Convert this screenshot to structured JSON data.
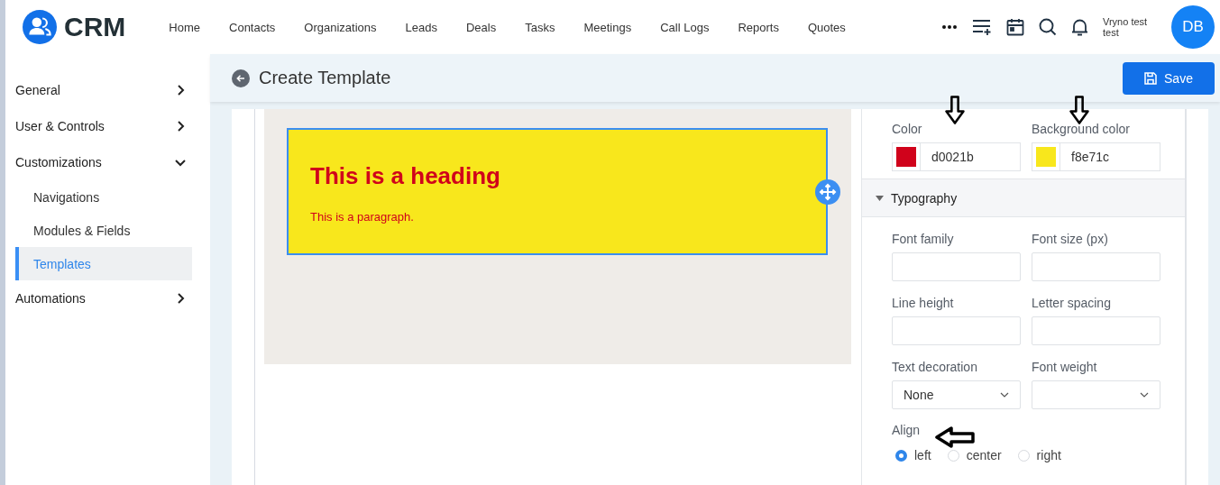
{
  "header": {
    "logo": "CRM",
    "nav": [
      {
        "label": "Home",
        "selected": false
      },
      {
        "label": "Contacts",
        "selected": false
      },
      {
        "label": "Organizations",
        "selected": false
      },
      {
        "label": "Leads",
        "selected": false
      },
      {
        "label": "Deals",
        "selected": false
      },
      {
        "label": "Tasks",
        "selected": false
      },
      {
        "label": "Meetings",
        "selected": false
      },
      {
        "label": "Call Logs",
        "selected": false
      },
      {
        "label": "Reports",
        "selected": false
      },
      {
        "label": "Quotes",
        "selected": false
      }
    ],
    "user_name": "Vryno test test",
    "avatar": "DB"
  },
  "sidebar": {
    "items": [
      {
        "label": "General",
        "expanded": false
      },
      {
        "label": "User & Controls",
        "expanded": false
      },
      {
        "label": "Customizations",
        "expanded": true,
        "children": [
          {
            "label": "Navigations",
            "selected": false
          },
          {
            "label": "Modules & Fields",
            "selected": false
          },
          {
            "label": "Templates",
            "selected": true
          }
        ]
      },
      {
        "label": "Automations",
        "expanded": false
      }
    ]
  },
  "page": {
    "title": "Create Template",
    "save_button": "Save"
  },
  "template": {
    "heading": "This is a heading",
    "paragraph": "This is a paragraph."
  },
  "style_panel": {
    "color_fields": [
      {
        "label": "Color",
        "value": "d0021b",
        "color": "#d0021b"
      },
      {
        "label": "Background color",
        "value": "f8e71c",
        "color": "#f8e71c"
      }
    ],
    "section": {
      "title": "Typography",
      "expanded": true
    },
    "fields": [
      {
        "kind": "input",
        "label": "Font family"
      },
      {
        "kind": "input",
        "label": "Font size (px)"
      },
      {
        "kind": "input",
        "label": "Line height"
      },
      {
        "kind": "input",
        "label": "Letter spacing"
      },
      {
        "kind": "select",
        "label": "Text decoration",
        "value": "None"
      },
      {
        "kind": "select",
        "label": "Font weight"
      }
    ],
    "align": {
      "label": "Align",
      "options": [
        {
          "label": "left",
          "selected": true
        },
        {
          "label": "center",
          "selected": false
        },
        {
          "label": "right",
          "selected": false
        }
      ]
    }
  }
}
